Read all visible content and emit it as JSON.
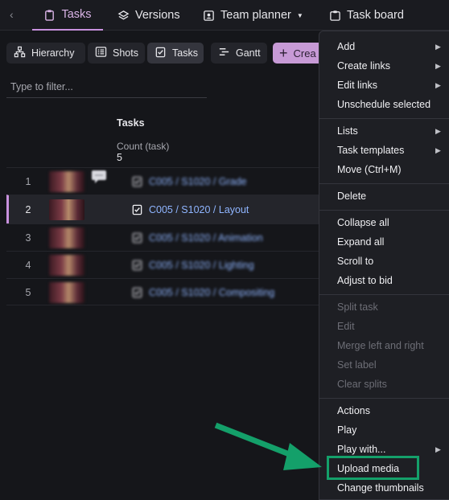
{
  "nav": {
    "tabs": [
      {
        "label": "Tasks",
        "icon": "clipboard-icon",
        "active": true
      },
      {
        "label": "Versions",
        "icon": "layers-icon"
      },
      {
        "label": "Team planner",
        "icon": "id-card-icon",
        "has_dropdown": true
      },
      {
        "label": "Task board",
        "icon": "board-icon"
      }
    ]
  },
  "toolbar": {
    "views": [
      {
        "label": "Hierarchy",
        "icon": "hierarchy-icon"
      },
      {
        "label": "Shots",
        "icon": "list-icon"
      },
      {
        "label": "Tasks",
        "icon": "clipboard-check-icon",
        "selected": true
      },
      {
        "label": "Gantt",
        "icon": "gantt-icon"
      }
    ],
    "create_label": "Crea"
  },
  "filter": {
    "placeholder": "Type to filter..."
  },
  "table": {
    "column_header": "Tasks",
    "count_label": "Count (task)",
    "count_value": "5",
    "rows": [
      {
        "num": "1",
        "title": "C005 / S1020 / Grade",
        "has_comment": true
      },
      {
        "num": "2",
        "title": "C005 / S1020 / Layout",
        "selected": true
      },
      {
        "num": "3",
        "title": "C005 / S1020 / Animation"
      },
      {
        "num": "4",
        "title": "C005 / S1020 / Lighting"
      },
      {
        "num": "5",
        "title": "C005 / S1020 / Compositing"
      }
    ]
  },
  "context_menu": {
    "items": [
      {
        "label": "Add",
        "submenu": true
      },
      {
        "label": "Create links",
        "submenu": true
      },
      {
        "label": "Edit links",
        "submenu": true
      },
      {
        "label": "Unschedule selected"
      },
      {
        "label": "Lists",
        "submenu": true
      },
      {
        "label": "Task templates",
        "submenu": true
      },
      {
        "label": "Move (Ctrl+M)"
      },
      {
        "label": "Delete"
      },
      {
        "label": "Collapse all"
      },
      {
        "label": "Expand all"
      },
      {
        "label": "Scroll to"
      },
      {
        "label": "Adjust to bid"
      },
      {
        "label": "Split task",
        "disabled": true
      },
      {
        "label": "Edit",
        "disabled": true
      },
      {
        "label": "Merge left and right",
        "disabled": true
      },
      {
        "label": "Set label",
        "disabled": true
      },
      {
        "label": "Clear splits",
        "disabled": true
      },
      {
        "label": "Actions"
      },
      {
        "label": "Play"
      },
      {
        "label": "Play with...",
        "submenu": true
      },
      {
        "label": "Upload media",
        "highlighted": true
      },
      {
        "label": "Change thumbnails"
      }
    ]
  },
  "annotation": {
    "color": "#14a06a"
  }
}
